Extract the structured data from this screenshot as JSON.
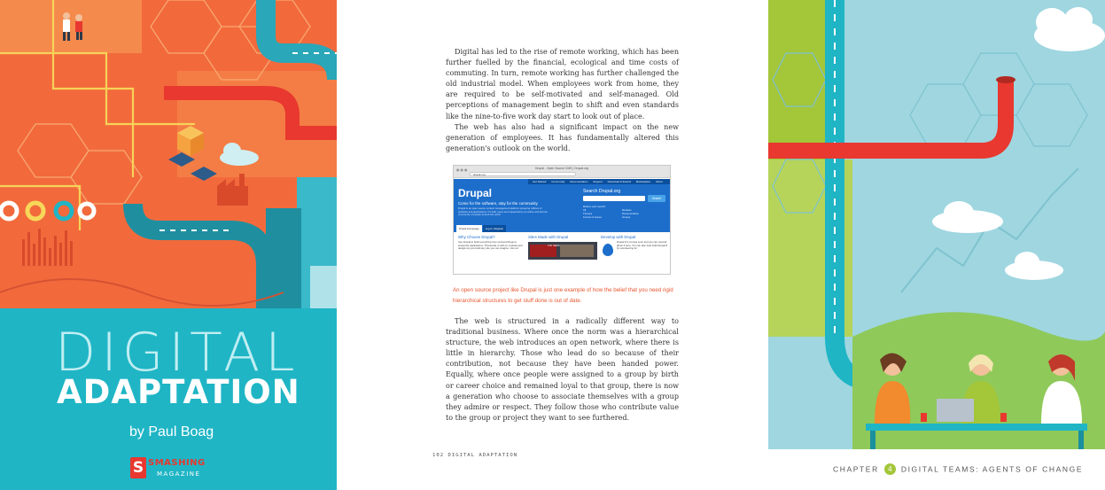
{
  "cover": {
    "title_line1": "DIGITAL",
    "title_line2": "ADAPTATION",
    "author": "by Paul Boag",
    "publisher_logo": {
      "mark": "S",
      "top": "SMASHING",
      "bottom": "MAGAZINE"
    },
    "colors": {
      "orange": "#f26a3c",
      "teal": "#1fb5c5",
      "red_pipe": "#e8382f"
    }
  },
  "page": {
    "paragraphs": [
      "Digital has led to the rise of remote working, which has been further fuelled by the financial, ecological and time costs of commuting. In turn, remote working has further challenged the old industrial model. When employees work from home, they are required to be self-motivated and self-managed. Old perceptions of management begin to shift and even standards like the nine-to-five work day start to look out of place.",
      "The web has also had a significant impact on the new generation of employees. It has fundamentally altered this generation's outlook on the world.",
      "The web is structured in a radically different way to traditional business. Where once the norm was a hierarchical structure, the web introduces an open network, where there is little in hierarchy. Those who lead do so because of their contribution, not because they have been handed power. Equally, where once people were assigned to a group by birth or career choice and remained loyal to that group, there is now a generation who choose to associate themselves with a group they admire or respect. They follow those who contribute value to the group or project they want to see furthered."
    ],
    "caption": "An open source project like Drupal is just one example of how the belief that you need rigid hierarchical structures to get stuff done is out of date.",
    "folio": "102  DIGITAL ADAPTATION",
    "screenshot": {
      "window_title": "Drupal - Open Source CMS | Drupal.org",
      "url": "drupal.org",
      "nav": [
        "Get Started",
        "Community",
        "Documentation",
        "Support",
        "Download & Extend",
        "Marketplace",
        "About"
      ],
      "logo": "Drupal",
      "tagline": "Come for the software, stay for the community",
      "description": "Drupal is an open source content management platform powering millions of websites and applications. It's built, used, and supported by an active and diverse community of people around the world.",
      "search_title": "Search Drupal.org",
      "search_button": "Search",
      "refine": "Refine your search:",
      "refine_options": [
        "All",
        "Modules",
        "Themes",
        "Documentation",
        "Forums & Issues",
        "Groups"
      ],
      "tabs": [
        "Drupal Homepage",
        "Log in / Register"
      ],
      "columns": [
        {
          "heading": "Why Choose Drupal?",
          "text": "Use Drupal to build everything from personal blogs to enterprise applications. Thousands of add-on modules and designs let you build any site you can imagine. Join us!"
        },
        {
          "heading": "Sites Made with Drupal",
          "text": ""
        },
        {
          "heading": "Develop with Drupal",
          "text": "Drupal 8 is coming soon and you can read all about it here. You can also help build Drupal 8 by volunteering for"
        }
      ],
      "image_label": "TOP NEWS"
    }
  },
  "chapter": {
    "label": "CHAPTER",
    "number": "4",
    "title": "DIGITAL TEAMS: AGENTS OF CHANGE",
    "colors": {
      "sky": "#9fd6e0",
      "green": "#a4c639",
      "red_pipe": "#e8382f"
    }
  }
}
